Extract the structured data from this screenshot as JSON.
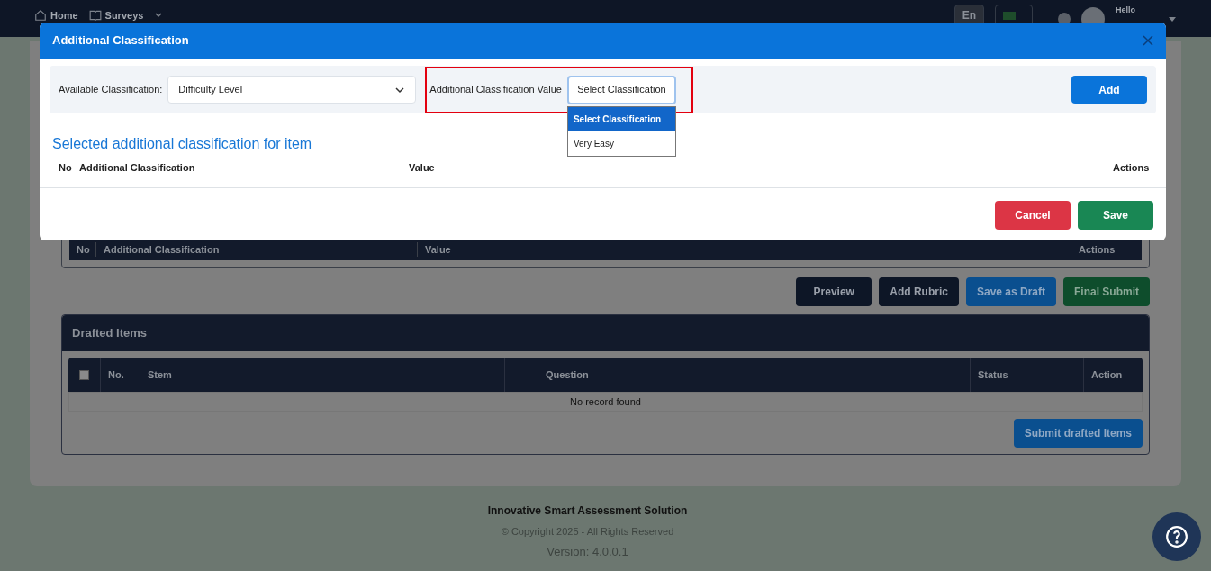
{
  "nav": {
    "items": [
      {
        "label": "Home"
      },
      {
        "label": "Surveys"
      }
    ],
    "language": "En",
    "greeting": "Hello"
  },
  "page": {
    "classification_columns": [
      "No",
      "Additional Classification",
      "Value",
      "Actions"
    ],
    "actions": [
      {
        "label": "Preview",
        "kind": "dark"
      },
      {
        "label": "Add Rubric",
        "kind": "dark"
      },
      {
        "label": "Save as Draft",
        "kind": "primary"
      },
      {
        "label": "Final Submit",
        "kind": "success"
      }
    ],
    "drafted": {
      "title": "Drafted Items",
      "select_all": {
        "checked": false
      },
      "columns": [
        "No.",
        "Stem",
        "",
        "Question",
        "Status",
        "Action"
      ],
      "empty": "No record found",
      "submit": "Submit drafted Items"
    }
  },
  "footer": {
    "title": "Innovative Smart Assessment Solution",
    "copyright": "© Copyright 2025 - All Rights Reserved",
    "version": "Version: 4.0.0.1"
  },
  "modal": {
    "title": "Additional Classification",
    "available_label": "Available Classification:",
    "available_value": "Difficulty Level",
    "value_label": "Additional Classification Value",
    "value_field": "Select Classification",
    "options": [
      {
        "label": "Select Classification",
        "selected": true
      },
      {
        "label": "Very Easy",
        "selected": false
      }
    ],
    "add": "Add",
    "section_title": "Selected additional classification for item",
    "columns": [
      "No",
      "Additional Classification",
      "Value",
      "Actions"
    ],
    "buttons": [
      {
        "label": "Cancel",
        "kind": "danger"
      },
      {
        "label": "Save",
        "kind": "success"
      }
    ]
  }
}
